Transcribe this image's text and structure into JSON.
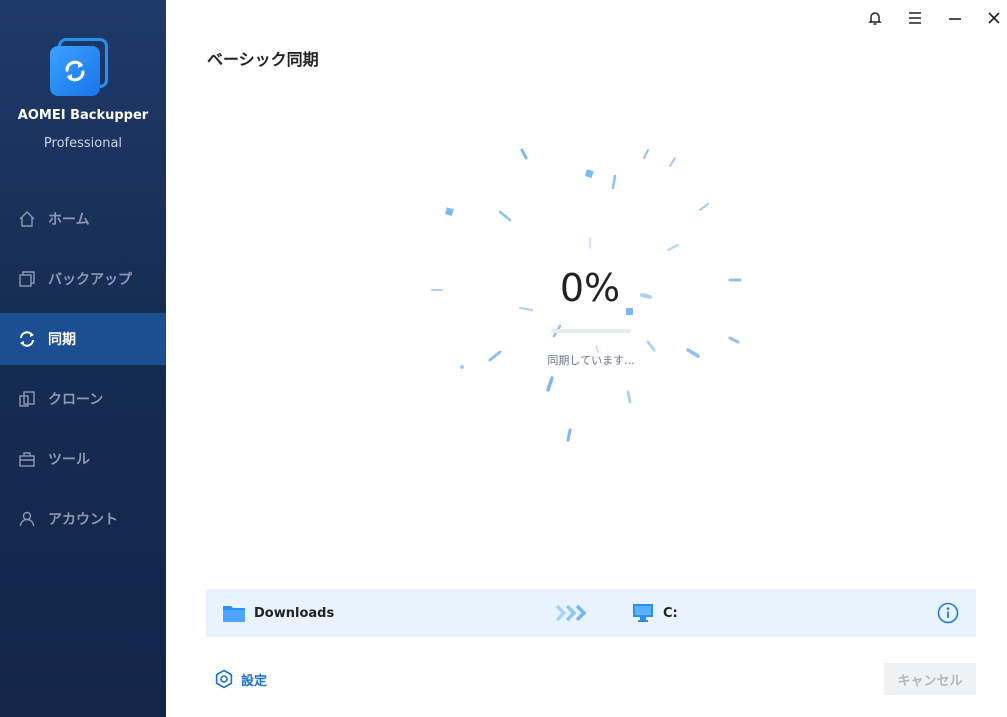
{
  "app": {
    "name": "AOMEI Backupper",
    "edition": "Professional"
  },
  "sidebar": {
    "items": [
      {
        "label": "ホーム",
        "icon": "home-icon"
      },
      {
        "label": "バックアップ",
        "icon": "backup-icon"
      },
      {
        "label": "同期",
        "icon": "sync-icon",
        "active": true
      },
      {
        "label": "クローン",
        "icon": "clone-icon"
      },
      {
        "label": "ツール",
        "icon": "tools-icon"
      },
      {
        "label": "アカウント",
        "icon": "account-icon"
      }
    ]
  },
  "titlebar": {
    "icons": [
      "bell-icon",
      "menu-icon",
      "minimize-icon",
      "close-icon"
    ]
  },
  "page": {
    "title": "ベーシック同期"
  },
  "progress": {
    "percent_text": "0%",
    "percent_value": 0,
    "status": "同期しています..."
  },
  "task": {
    "source": "Downloads",
    "destination": "C:"
  },
  "footer": {
    "settings_label": "設定",
    "cancel_label": "キャンセル"
  },
  "colors": {
    "accent": "#1a7ce8",
    "sidebar_bg": "#172c52",
    "sidebar_active": "#1c4f91",
    "strip_bg": "#e8f3fd"
  }
}
